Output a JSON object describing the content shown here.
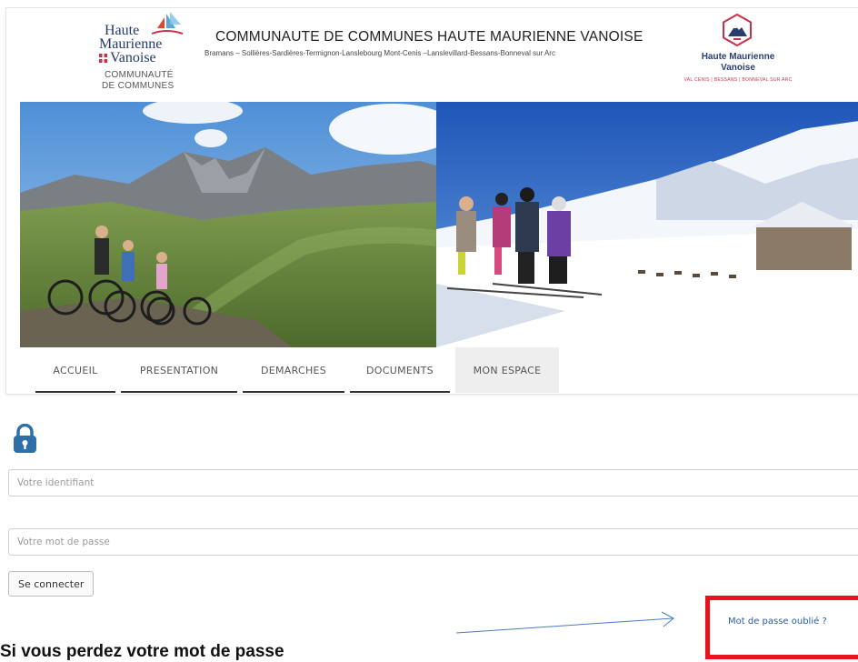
{
  "header": {
    "logo_left": {
      "line1": "Haute",
      "line2": "Maurienne",
      "line3": "Vanoise",
      "line4": "COMMUNAUTÉ",
      "line5": "DE COMMUNES"
    },
    "title": "COMMUNAUTE DE COMMUNES HAUTE MAURIENNE VANOISE",
    "subtitle": "Bramans – Sollières-Sardières-Termignon-Lanslebourg Mont-Cenis –Lanslevillard-Bessans-Bonneval sur Arc",
    "logo_right": {
      "line1": "Haute Maurienne",
      "line2": "Vanoise",
      "line3": "VAL CENIS | BESSANS | BONNEVAL SUR ARC"
    }
  },
  "nav": {
    "tabs": [
      {
        "label": "ACCUEIL",
        "active": false
      },
      {
        "label": "PRESENTATION",
        "active": false
      },
      {
        "label": "DEMARCHES",
        "active": false
      },
      {
        "label": "DOCUMENTS",
        "active": false
      },
      {
        "label": "MON ESPACE",
        "active": true
      }
    ]
  },
  "login": {
    "lock_icon": "lock-icon",
    "username_placeholder": "Votre identifiant",
    "password_placeholder": "Votre mot de passe",
    "submit_label": "Se connecter",
    "forgot_label": "Mot de passe oublié ?"
  },
  "annotation": {
    "caption": "Si vous perdez votre mot de passe",
    "highlight_color": "#e8131e",
    "arrow_color": "#4a7bc4"
  },
  "colors": {
    "brand_navy": "#223a6b",
    "brand_red": "#c9304a",
    "link": "#2a5aa8",
    "lock": "#2f6fa8"
  }
}
